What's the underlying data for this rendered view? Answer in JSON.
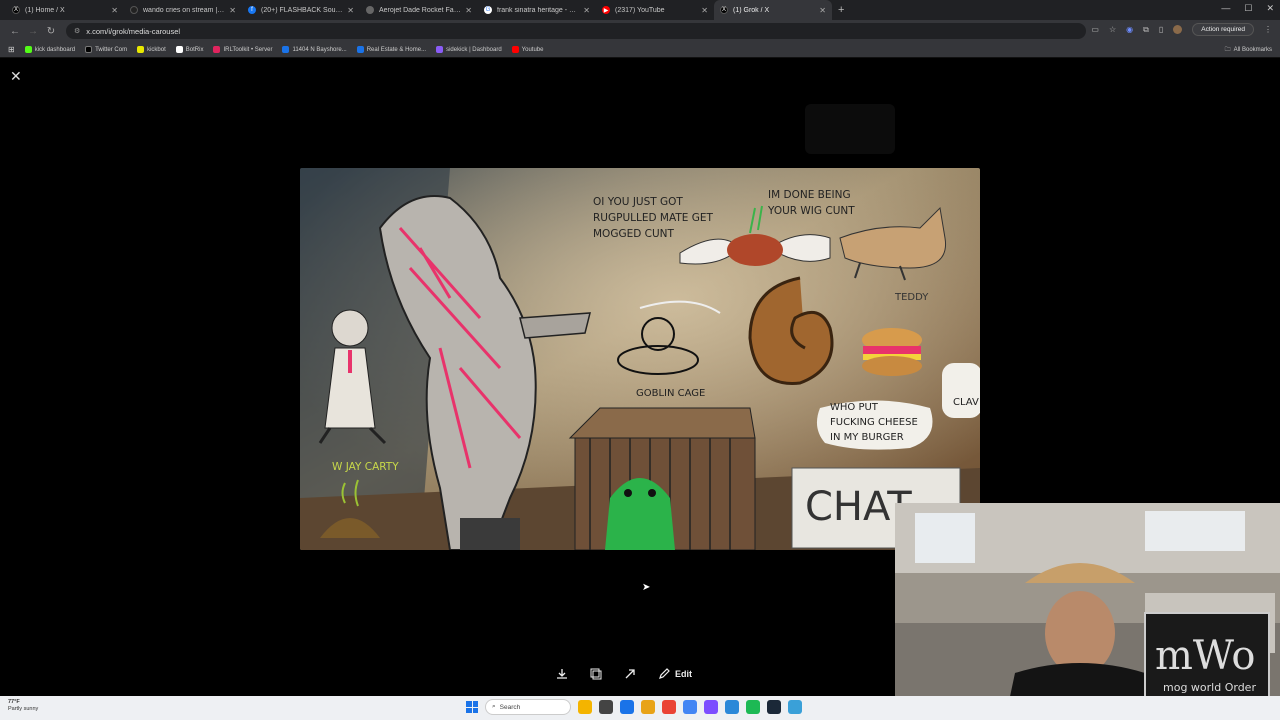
{
  "browser": {
    "tabs": [
      {
        "title": "(1) Home / X",
        "icon": "x-logo-icon",
        "color": "#000000"
      },
      {
        "title": "wando cries on stream | Looks",
        "icon": "kick-icon",
        "color": "#222222"
      },
      {
        "title": "(20+) FLASHBACK South Florid",
        "icon": "facebook-icon",
        "color": "#1877f2"
      },
      {
        "title": "Aerojet Dade Rocket Facility | A",
        "icon": "globe-icon",
        "color": "#666666"
      },
      {
        "title": "frank sinatra heritage - Google",
        "icon": "google-icon",
        "color": "#4285f4"
      },
      {
        "title": "(2317) YouTube",
        "icon": "youtube-icon",
        "color": "#ff0000"
      },
      {
        "title": "(1) Grok / X",
        "icon": "x-logo-icon",
        "color": "#000000",
        "active": true
      }
    ],
    "new_tab": "+",
    "url": "x.com/i/grok/media-carousel",
    "action_required": "Action required",
    "bookmarks": [
      {
        "label": "kick dashboard",
        "color": "#53fc18"
      },
      {
        "label": "Twitter Com",
        "color": "#000000"
      },
      {
        "label": "kickbot",
        "color": "#e8e800"
      },
      {
        "label": "BotRix",
        "color": "#ffffff"
      },
      {
        "label": "IRLToolkit • Server",
        "color": "#e0245e"
      },
      {
        "label": "11404 N Bayshore...",
        "color": "#1a73e8"
      },
      {
        "label": "Real Estate & Home...",
        "color": "#1a73e8"
      },
      {
        "label": "sidekick | Dashboard",
        "color": "#8a5cf6"
      },
      {
        "label": "Youtube",
        "color": "#ff0000"
      }
    ],
    "all_bookmarks": "All Bookmarks"
  },
  "artwork": {
    "texts": {
      "speech_top": [
        "OI YOU JUST GOT",
        "RUGPULLED MATE GET",
        "MOGGED CUNT"
      ],
      "wig": [
        "IM DONE BEING",
        "YOUR WIG CUNT"
      ],
      "teddy": "TEDDY",
      "goblin_cage": "GOBLIN CAGE",
      "jay": "W JAY CARTY",
      "burger": [
        "WHO PUT",
        "FUCKING CHEESE",
        "IN MY BURGER"
      ],
      "clav": "CLAV",
      "chat": "CHAT"
    },
    "colors": {
      "wall": "#8b7355",
      "floor": "#5c4631",
      "pink": "#e8336b",
      "goblin": "#2bb34a"
    }
  },
  "toolbar": {
    "download_icon": "download-icon",
    "copy_icon": "copy-icon",
    "share_icon": "share-icon",
    "edit_label": "Edit"
  },
  "taskbar": {
    "weather_temp": "77°F",
    "weather_desc": "Partly sunny",
    "search_label": "Search",
    "apps": [
      "#f4b400",
      "#444444",
      "#1a73e8",
      "#e8a317",
      "#ea4335",
      "#4285f4",
      "#7c4dff",
      "#2b88d8",
      "#1db954",
      "#1b2838",
      "#3aa0d8"
    ]
  },
  "stream_overlay": {
    "logo_text": "mog world Order",
    "logo_mark": "mWo"
  }
}
